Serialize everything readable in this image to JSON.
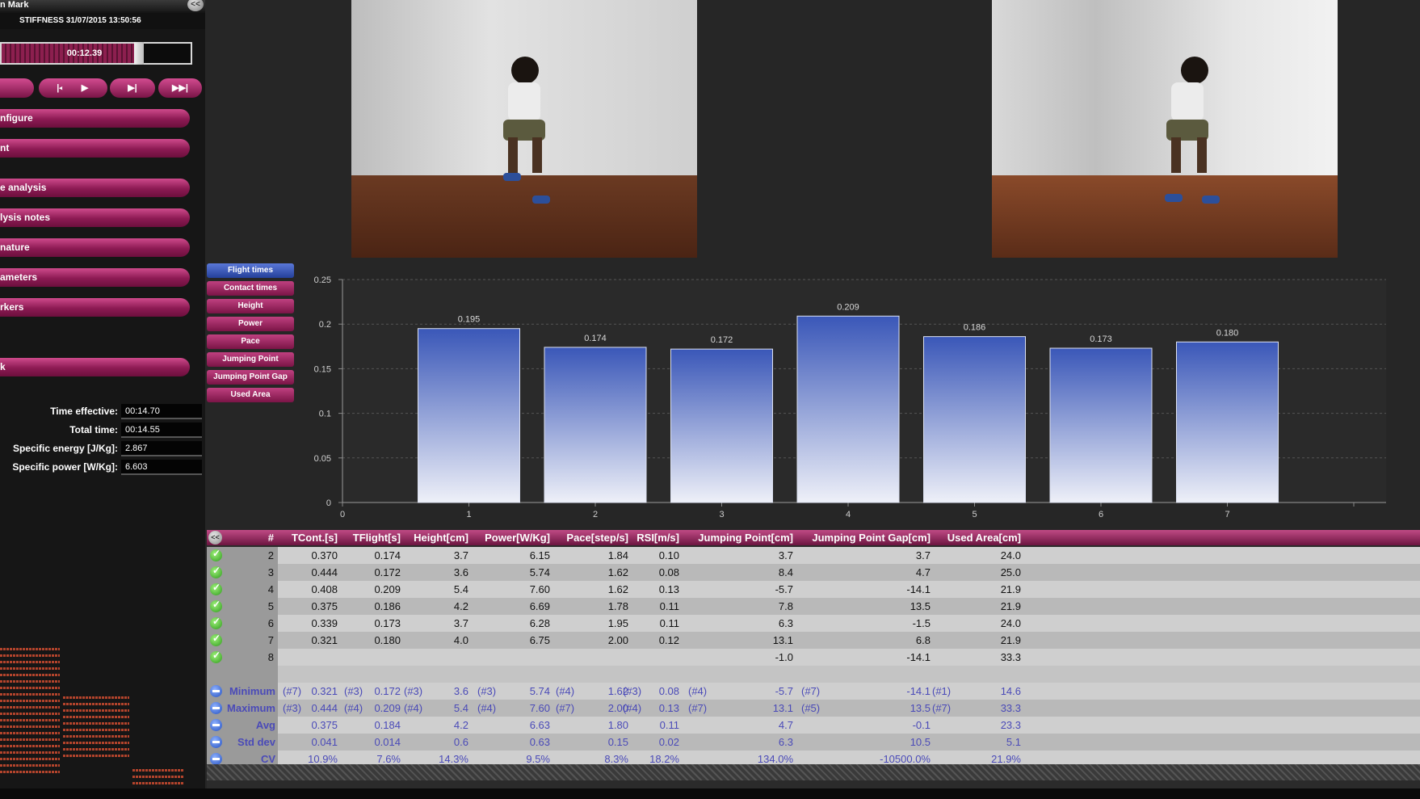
{
  "header": {
    "user_partial": "n Mark",
    "collapse_label": "<<"
  },
  "session": {
    "title": "STIFFNESS 31/07/2015 13:50:56"
  },
  "player": {
    "time": "00:12.39",
    "progress": 0.76,
    "buttons": [
      "|◀",
      "▶",
      "▶|",
      "▶▶|"
    ]
  },
  "menu": [
    "nfigure",
    "nt",
    "e analysis",
    "lysis notes",
    "nature",
    "ameters",
    "rkers",
    "k"
  ],
  "stats": [
    {
      "label": "Time effective:",
      "value": "00:14.70"
    },
    {
      "label": "Total time:",
      "value": "00:14.55"
    },
    {
      "label": "Specific energy [J/Kg]:",
      "value": "2.867"
    },
    {
      "label": "Specific power [W/Kg]:",
      "value": "6.603"
    }
  ],
  "tabs": [
    {
      "label": "Flight times",
      "active": true
    },
    {
      "label": "Contact times",
      "active": false
    },
    {
      "label": "Height",
      "active": false
    },
    {
      "label": "Power",
      "active": false
    },
    {
      "label": "Pace",
      "active": false
    },
    {
      "label": "Jumping Point",
      "active": false
    },
    {
      "label": "Jumping Point Gap",
      "active": false
    },
    {
      "label": "Used Area",
      "active": false
    }
  ],
  "chart_data": {
    "type": "bar",
    "categories": [
      "1",
      "2",
      "3",
      "4",
      "5",
      "6",
      "7"
    ],
    "values": [
      0.195,
      0.174,
      0.172,
      0.209,
      0.186,
      0.173,
      0.18
    ],
    "data_labels": [
      "0.195",
      "0.174",
      "0.172",
      "0.209",
      "0.186",
      "0.173",
      "0.180"
    ],
    "x_ticks": [
      "0",
      "1",
      "2",
      "3",
      "4",
      "5",
      "6",
      "7"
    ],
    "y_ticks": [
      "0",
      "0.05",
      "0.1",
      "0.15",
      "0.2",
      "0.25"
    ],
    "ylim": [
      0,
      0.25
    ],
    "grid": true,
    "colors": {
      "top": "#3a57b8",
      "bottom": "#eef0f8"
    }
  },
  "table": {
    "headers": [
      "#",
      "TCont.[s]",
      "TFlight[s]",
      "Height[cm]",
      "Power[W/Kg]",
      "Pace[step/s]",
      "RSI[m/s]",
      "Jumping Point[cm]",
      "Jumping Point Gap[cm]",
      "Used Area[cm]"
    ],
    "rows": [
      [
        "2",
        "0.370",
        "0.174",
        "3.7",
        "6.15",
        "1.84",
        "0.10",
        "3.7",
        "3.7",
        "24.0"
      ],
      [
        "3",
        "0.444",
        "0.172",
        "3.6",
        "5.74",
        "1.62",
        "0.08",
        "8.4",
        "4.7",
        "25.0"
      ],
      [
        "4",
        "0.408",
        "0.209",
        "5.4",
        "7.60",
        "1.62",
        "0.13",
        "-5.7",
        "-14.1",
        "21.9"
      ],
      [
        "5",
        "0.375",
        "0.186",
        "4.2",
        "6.69",
        "1.78",
        "0.11",
        "7.8",
        "13.5",
        "21.9"
      ],
      [
        "6",
        "0.339",
        "0.173",
        "3.7",
        "6.28",
        "1.95",
        "0.11",
        "6.3",
        "-1.5",
        "24.0"
      ],
      [
        "7",
        "0.321",
        "0.180",
        "4.0",
        "6.75",
        "2.00",
        "0.12",
        "13.1",
        "6.8",
        "21.9"
      ],
      [
        "8",
        "",
        "",
        "",
        "",
        "",
        "",
        "-1.0",
        "-14.1",
        "33.3"
      ]
    ],
    "summary": [
      {
        "label": "Minimum",
        "cells": [
          [
            "(#7)",
            "0.321"
          ],
          [
            "(#3)",
            "0.172"
          ],
          [
            "(#3)",
            "3.6"
          ],
          [
            "(#3)",
            "5.74"
          ],
          [
            "(#4)",
            "1.62"
          ],
          [
            "(#3)",
            "0.08"
          ],
          [
            "(#4)",
            "-5.7"
          ],
          [
            "(#7)",
            "-14.1"
          ],
          [
            "(#1)",
            "14.6"
          ]
        ]
      },
      {
        "label": "Maximum",
        "cells": [
          [
            "(#3)",
            "0.444"
          ],
          [
            "(#4)",
            "0.209"
          ],
          [
            "(#4)",
            "5.4"
          ],
          [
            "(#4)",
            "7.60"
          ],
          [
            "(#7)",
            "2.00"
          ],
          [
            "(#4)",
            "0.13"
          ],
          [
            "(#7)",
            "13.1"
          ],
          [
            "(#5)",
            "13.5"
          ],
          [
            "(#7)",
            "33.3"
          ]
        ]
      },
      {
        "label": "Avg",
        "cells": [
          [
            "",
            "0.375"
          ],
          [
            "",
            "0.184"
          ],
          [
            "",
            "4.2"
          ],
          [
            "",
            "6.63"
          ],
          [
            "",
            "1.80"
          ],
          [
            "",
            "0.11"
          ],
          [
            "",
            "4.7"
          ],
          [
            "",
            "-0.1"
          ],
          [
            "",
            "23.3"
          ]
        ]
      },
      {
        "label": "Std dev",
        "cells": [
          [
            "",
            "0.041"
          ],
          [
            "",
            "0.014"
          ],
          [
            "",
            "0.6"
          ],
          [
            "",
            "0.63"
          ],
          [
            "",
            "0.15"
          ],
          [
            "",
            "0.02"
          ],
          [
            "",
            "6.3"
          ],
          [
            "",
            "10.5"
          ],
          [
            "",
            "5.1"
          ]
        ]
      },
      {
        "label": "CV",
        "cells": [
          [
            "",
            "10.9%"
          ],
          [
            "",
            "7.6%"
          ],
          [
            "",
            "14.3%"
          ],
          [
            "",
            "9.5%"
          ],
          [
            "",
            "8.3%"
          ],
          [
            "",
            "18.2%"
          ],
          [
            "",
            "134.0%"
          ],
          [
            "",
            "-10500.0%"
          ],
          [
            "",
            "21.9%"
          ]
        ]
      }
    ]
  }
}
